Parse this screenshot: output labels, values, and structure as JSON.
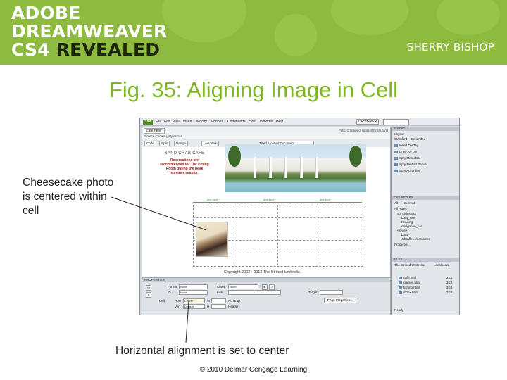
{
  "banner": {
    "brand_line1": "ADOBE",
    "brand_line2": "DREAMWEAVER",
    "brand_line3_prefix": "CS4",
    "brand_line3_suffix": "REVEALED",
    "author": "SHERRY BISHOP",
    "colors": {
      "background": "#8dba3f",
      "text": "#ffffff",
      "dark": "#1d2608"
    }
  },
  "slide": {
    "title": "Fig. 35: Aligning Image in Cell",
    "title_color": "#7fb624",
    "callout_1": "Cheesecake photo is centered within cell",
    "callout_2": "Horizontal alignment is set to center",
    "copyright": "© 2010 Delmar Cengage Learning"
  },
  "screenshot": {
    "app_logo": "Dw",
    "menu": [
      "File",
      "Edit",
      "View",
      "Insert",
      "Modify",
      "Format",
      "Commands",
      "Site",
      "Window",
      "Help"
    ],
    "workspace": "DESIGNER",
    "document_tab": "cafe.html*",
    "file_path": "Path: C:\\striped_umbrella\\cafe.html",
    "related_files": [
      "Source Code",
      "su_styles.css"
    ],
    "doc_toolbar": {
      "code": "Code",
      "split": "Split",
      "design": "Design",
      "live_view": "Live View",
      "title_label": "Title:",
      "title_value": "Untitled Document"
    },
    "page": {
      "logo_text": "SAND CRAB CAFE",
      "reservations": "Reservations are recommended for The Dining Room during the peak summer season.",
      "width_labels": [
        "ooo (oo) ~",
        "ooo (oo) ~",
        "ooo (oo) ~"
      ],
      "footer": "Copyright 2002 - 2012 The Striped Umbrella"
    },
    "status": {
      "tag_path": "<body> <table> <tr> <td> <img>",
      "zoom_info": "100% ~ 813 x 486 ~ 76K / 11 sec  Unicode (UTF-8)"
    },
    "properties": {
      "header": "PROPERTIES",
      "format_label": "Format",
      "format_value": "None",
      "class_label": "Class",
      "class_value": "None",
      "id_label": "ID",
      "id_value": "None",
      "link_label": "Link",
      "target_label": "Target",
      "cell_label": "Cell",
      "horz_label": "Horz",
      "horz_value": "Center",
      "vert_label": "Vert",
      "vert_value": "Default",
      "w_label": "W",
      "h_label": "H",
      "nowrap_label": "No wrap",
      "header_label": "Header",
      "bold": "B",
      "italic": "I",
      "page_properties": "Page Properties..."
    },
    "panels": {
      "insert_header": "INSERT",
      "insert_category": "Layout",
      "insert_tabs": [
        "Standard",
        "Expanded"
      ],
      "insert_items": [
        "Insert Div Tag",
        "Draw AP Div",
        "Spry Menu Bar",
        "Spry Tabbed Panels",
        "Spry Accordion"
      ],
      "css_header": "CSS STYLES",
      "css_tabs": [
        "All",
        "Current"
      ],
      "css_rules_label": "All Rules",
      "css_rules": [
        "su_styles.css",
        "body_text",
        "heading",
        "navigation_bar",
        "<style>",
        "body",
        ".tdCaffe..../container"
      ],
      "properties_label": "Properties",
      "files_header": "FILES",
      "files_site": "The Striped Umbrella",
      "files_view": "Local view",
      "files": [
        {
          "name": "cafe.html",
          "size": "2KB"
        },
        {
          "name": "cruises.html",
          "size": "3KB"
        },
        {
          "name": "fishing.html",
          "size": "3KB"
        },
        {
          "name": "index.html",
          "size": "7KB"
        }
      ],
      "files_status": "Ready"
    }
  }
}
